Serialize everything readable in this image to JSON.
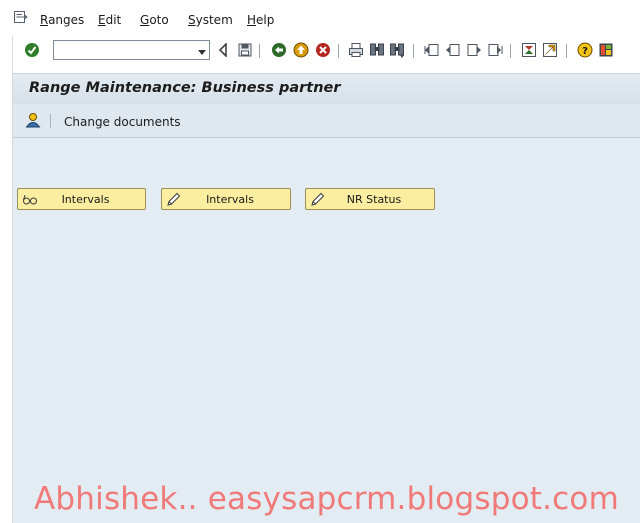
{
  "menu": {
    "items": [
      {
        "key": "ranges",
        "accel": "R",
        "rest": "anges"
      },
      {
        "key": "edit",
        "accel": "E",
        "rest": "dit"
      },
      {
        "key": "goto",
        "accel": "G",
        "rest": "oto"
      },
      {
        "key": "system",
        "accel": "S",
        "rest": "ystem"
      },
      {
        "key": "help",
        "accel": "H",
        "rest": "elp"
      }
    ]
  },
  "toolbar": {
    "command_field_value": "",
    "icons": [
      "enter-checkmark-icon",
      "back-icon",
      "save-icon",
      "back-green-icon",
      "exit-yellow-icon",
      "cancel-red-icon",
      "print-icon",
      "find-icon",
      "find-next-icon",
      "first-page-icon",
      "previous-page-icon",
      "next-page-icon",
      "last-page-icon",
      "create-session-icon",
      "shortcut-icon",
      "help-icon",
      "layout-icon"
    ]
  },
  "title": "Range Maintenance: Business partner",
  "app_toolbar": {
    "change_documents_label": "Change documents"
  },
  "buttons": {
    "intervals_display_label": "Intervals",
    "intervals_change_label": "Intervals",
    "nr_status_label": "NR Status"
  },
  "watermark": "Abhishek.. easysapcrm.blogspot.com",
  "colors": {
    "title_bg": "#d7e0e9",
    "workarea_bg": "#e3ebf3",
    "button_bg": "#fbeea0",
    "watermark": "#f07a78"
  }
}
